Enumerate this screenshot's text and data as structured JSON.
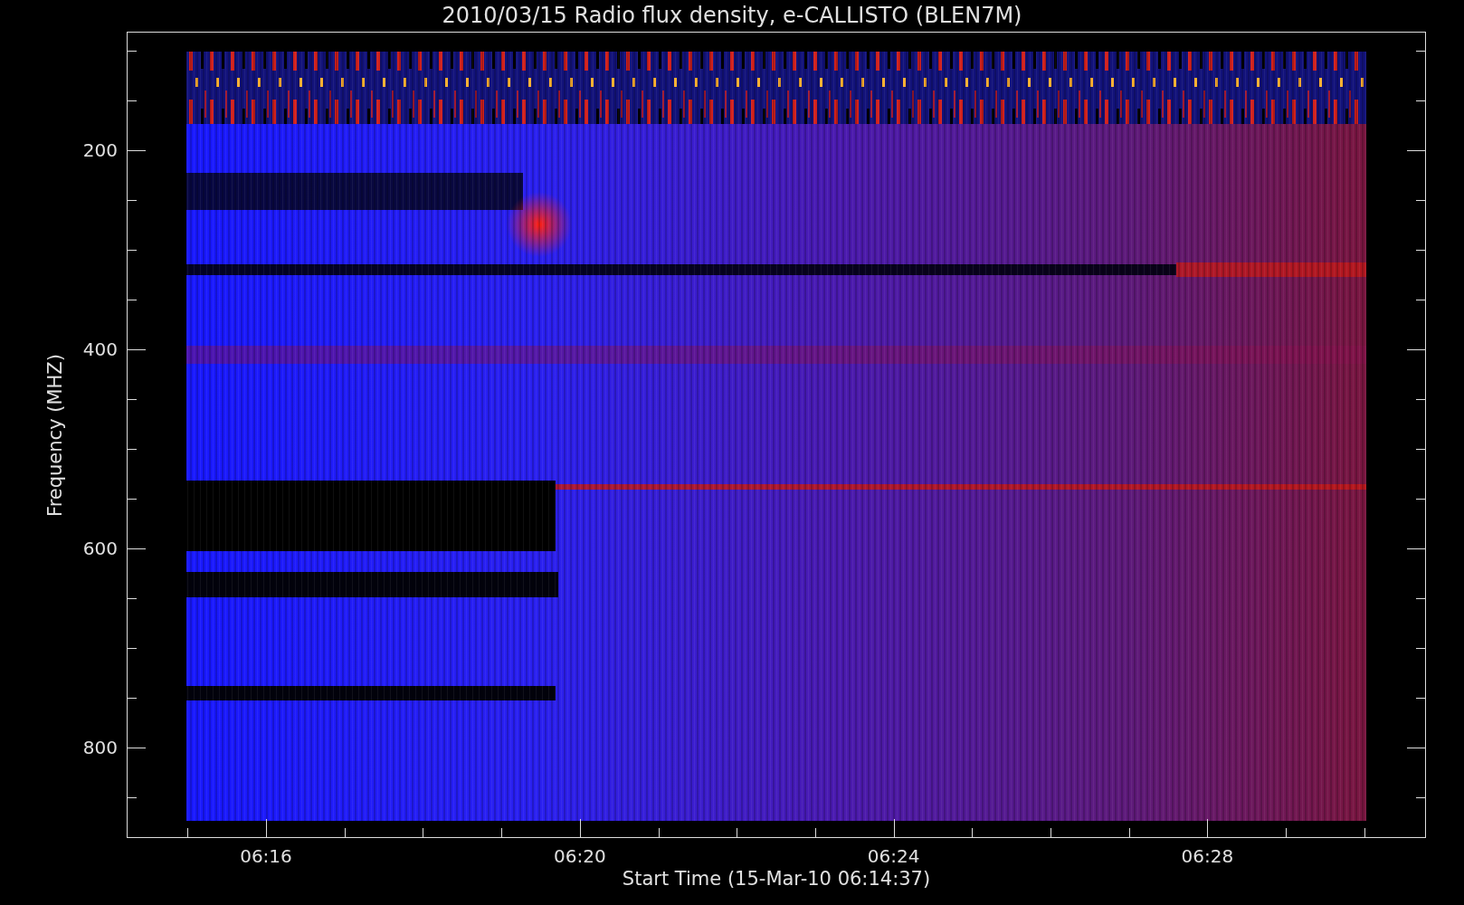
{
  "title": "2010/03/15  Radio flux density, e-CALLISTO (BLEN7M)",
  "plot": {
    "ylabel": "Frequency (MHZ)",
    "xlabel": "Start Time (15-Mar-10 06:14:37)",
    "yticks": [
      "200",
      "400",
      "600",
      "800"
    ],
    "xticks": [
      "06:16",
      "06:20",
      "06:24",
      "06:28"
    ]
  }
}
